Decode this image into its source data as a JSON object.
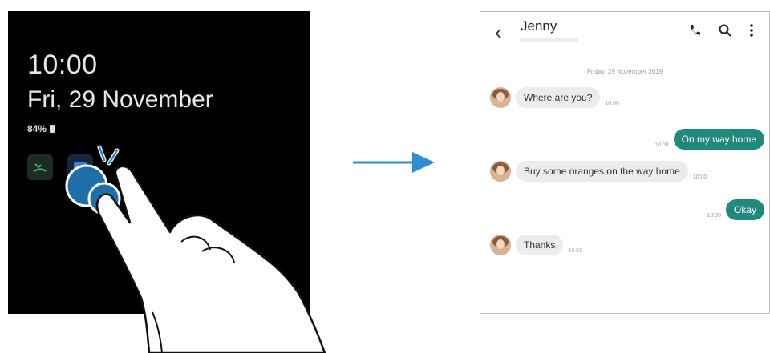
{
  "aod": {
    "time": "10:00",
    "date": "Fri, 29 November",
    "battery": "84%"
  },
  "chat": {
    "contact_name": "Jenny",
    "date_label": "Friday, 29 November 2019",
    "messages": [
      {
        "direction": "in",
        "text": "Where are you?",
        "time": "10:00"
      },
      {
        "direction": "out",
        "text": "On my way home",
        "time": "10:00"
      },
      {
        "direction": "in",
        "text": "Buy some oranges on the way home",
        "time": "10:00"
      },
      {
        "direction": "out",
        "text": "Okay",
        "time": "10:00"
      },
      {
        "direction": "in",
        "text": "Thanks",
        "time": "10:01"
      }
    ]
  },
  "colors": {
    "outgoing_bubble": "#1f8a7c",
    "arrow": "#2e8fd0",
    "finger_circle": "#1e6fa8"
  },
  "icons": {
    "back": "chevron-left-icon",
    "call": "phone-icon",
    "search": "search-icon",
    "more": "more-vertical-icon",
    "missed_call": "missed-call-icon",
    "message": "message-icon"
  }
}
